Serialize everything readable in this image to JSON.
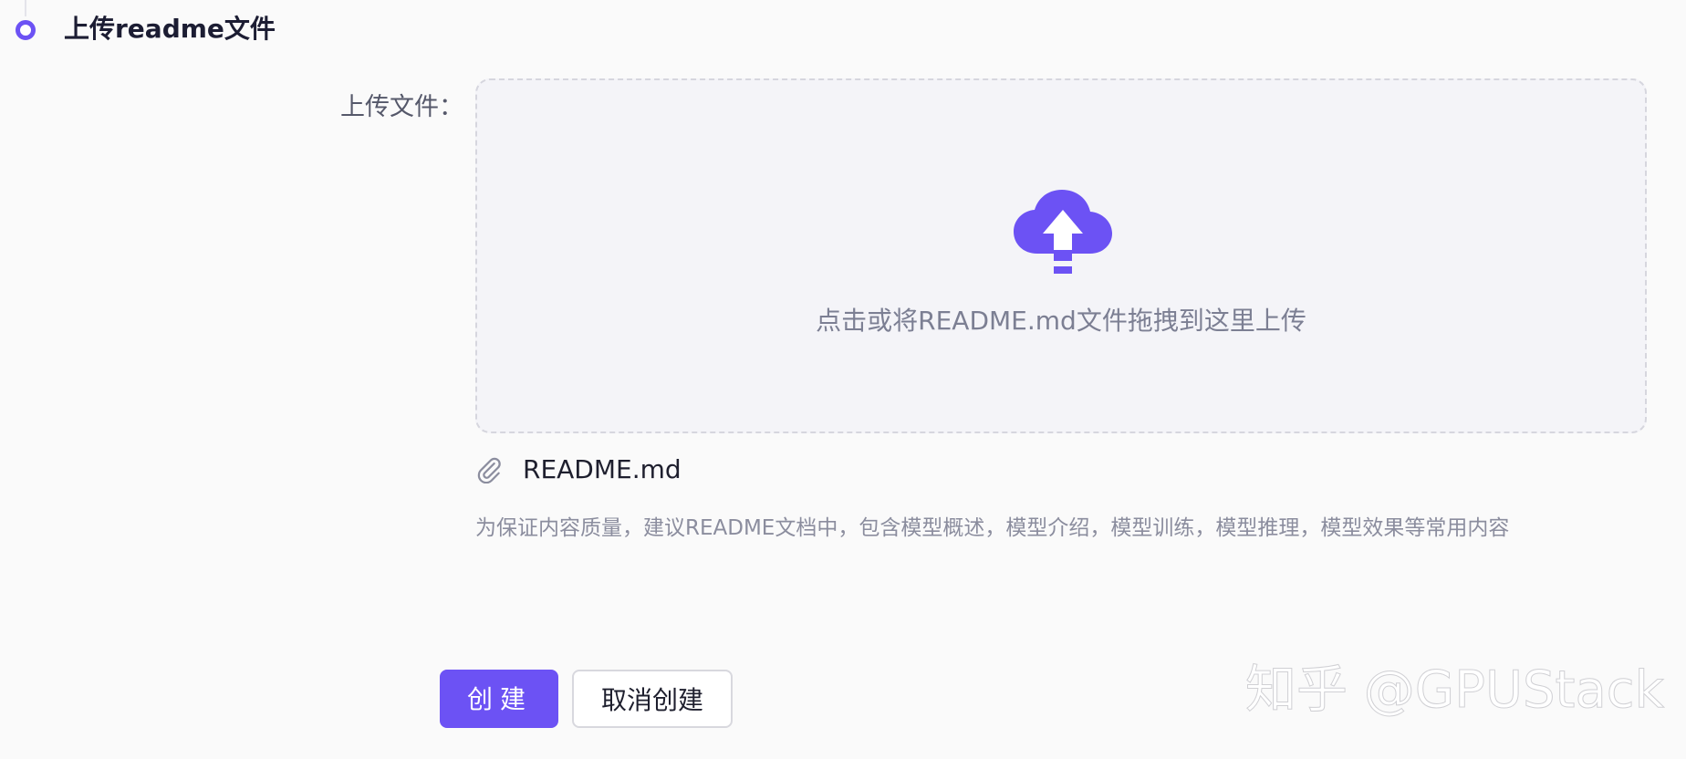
{
  "step": {
    "title": "上传readme文件"
  },
  "form": {
    "upload_label": "上传文件："
  },
  "dropzone": {
    "icon": "cloud-upload-icon",
    "text": "点击或将README.md文件拖拽到这里上传"
  },
  "file_list": [
    {
      "icon": "paperclip-icon",
      "name": "README.md"
    }
  ],
  "hint": "为保证内容质量，建议README文档中，包含模型概述，模型介绍，模型训练，模型推理，模型效果等常用内容",
  "actions": {
    "create_label": "创建",
    "cancel_label": "取消创建"
  },
  "watermark": "知乎 @GPUStack",
  "colors": {
    "accent": "#6c52f4",
    "title": "#1c1d33",
    "muted": "#8b8d9e",
    "dropzone_bg": "#f4f4f8"
  }
}
